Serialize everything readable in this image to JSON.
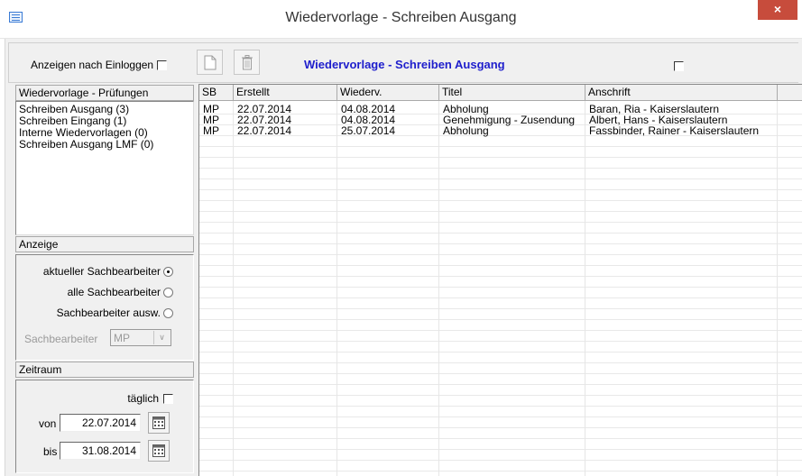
{
  "window": {
    "title": "Wiedervorlage - Schreiben Ausgang",
    "close_glyph": "×"
  },
  "toolbar": {
    "show_after_login_label": "Anzeigen nach Einloggen",
    "show_after_login_checked": false,
    "header_title": "Wiedervorlage - Schreiben Ausgang",
    "header_checkbox_checked": false,
    "accent_color": "#1e1ecc"
  },
  "left": {
    "checks_label": "Wiedervorlage - Prüfungen",
    "checks_items": [
      "Schreiben Ausgang (3)",
      "Schreiben Eingang (1)",
      "Interne Wiedervorlagen (0)",
      "Schreiben Ausgang LMF (0)"
    ],
    "display_label": "Anzeige",
    "radio_current": "aktueller Sachbearbeiter",
    "radio_all": "alle Sachbearbeiter",
    "radio_select": "Sachbearbeiter ausw.",
    "selected_radio": "aktueller Sachbearbeiter",
    "clerk_label": "Sachbearbeiter",
    "clerk_value": "MP",
    "period_label": "Zeitraum",
    "daily_label": "täglich",
    "daily_checked": false,
    "from_label": "von",
    "from_value": "22.07.2014",
    "to_label": "bis",
    "to_value": "31.08.2014"
  },
  "table": {
    "columns": [
      "SB",
      "Erstellt",
      "Wiederv.",
      "Titel",
      "Anschrift"
    ],
    "rows": [
      [
        "MP",
        "22.07.2014",
        "04.08.2014",
        "Abholung",
        "Baran, Ria - Kaiserslautern"
      ],
      [
        "MP",
        "22.07.2014",
        "04.08.2014",
        "Genehmigung - Zusendung",
        "Albert, Hans - Kaiserslautern"
      ],
      [
        "MP",
        "22.07.2014",
        "25.07.2014",
        "Abholung",
        "Fassbinder, Rainer - Kaiserslautern"
      ]
    ]
  }
}
